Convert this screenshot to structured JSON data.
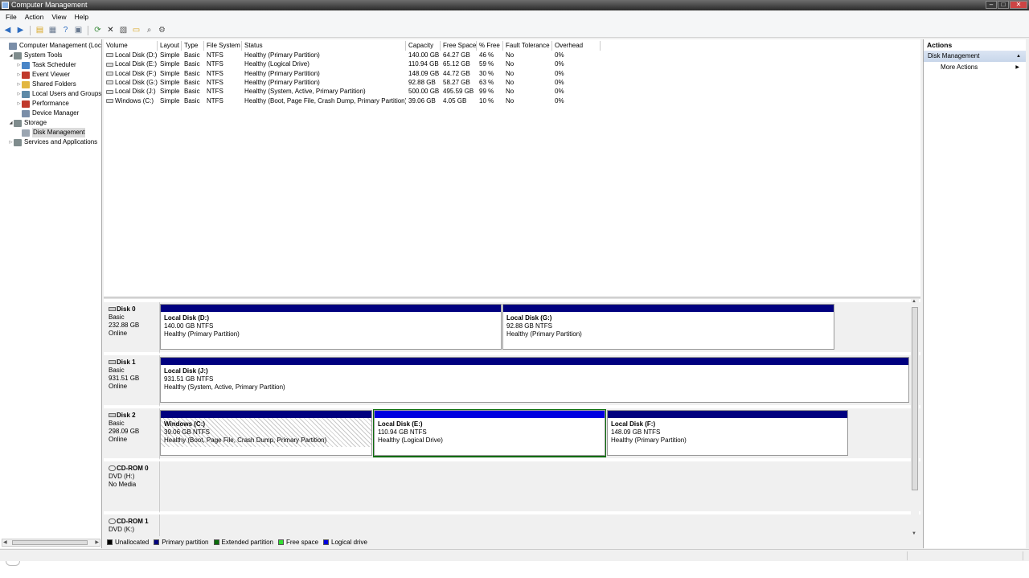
{
  "window": {
    "title": "Computer Management",
    "buttons": [
      "minimize",
      "maximize",
      "close"
    ]
  },
  "menu": [
    "File",
    "Action",
    "View",
    "Help"
  ],
  "toolbar": [
    "back-icon",
    "forward-icon",
    "up-folder-icon",
    "show-tree-icon",
    "help-icon",
    "show-hide-icon",
    "refresh-icon",
    "delete-icon",
    "properties-icon",
    "folder-open-icon",
    "search-icon",
    "settings-icon"
  ],
  "tree": [
    {
      "label": "Computer Management (Local",
      "level": 0,
      "expander": "",
      "icon": "computer-icon",
      "color": "#7a8ea8"
    },
    {
      "label": "System Tools",
      "level": 1,
      "expander": "◢",
      "icon": "tools-icon",
      "color": "#7f8c8d"
    },
    {
      "label": "Task Scheduler",
      "level": 2,
      "expander": "▷",
      "icon": "clock-icon",
      "color": "#4a86c8"
    },
    {
      "label": "Event Viewer",
      "level": 2,
      "expander": "▷",
      "icon": "event-viewer-icon",
      "color": "#c0392b"
    },
    {
      "label": "Shared Folders",
      "level": 2,
      "expander": "▷",
      "icon": "shared-folder-icon",
      "color": "#e2b740"
    },
    {
      "label": "Local Users and Groups",
      "level": 2,
      "expander": "▷",
      "icon": "users-icon",
      "color": "#5d8aa8"
    },
    {
      "label": "Performance",
      "level": 2,
      "expander": "▷",
      "icon": "performance-icon",
      "color": "#c0392b"
    },
    {
      "label": "Device Manager",
      "level": 2,
      "expander": "",
      "icon": "device-manager-icon",
      "color": "#7a8ea8"
    },
    {
      "label": "Storage",
      "level": 1,
      "expander": "◢",
      "icon": "storage-icon",
      "color": "#7f8c8d"
    },
    {
      "label": "Disk Management",
      "level": 2,
      "expander": "",
      "icon": "disk-management-icon",
      "color": "#9aa5b1",
      "selected": true
    },
    {
      "label": "Services and Applications",
      "level": 1,
      "expander": "▷",
      "icon": "services-icon",
      "color": "#7f8c8d"
    }
  ],
  "volume_table": {
    "columns": [
      "Volume",
      "Layout",
      "Type",
      "File System",
      "Status",
      "Capacity",
      "Free Space",
      "% Free",
      "Fault Tolerance",
      "Overhead"
    ],
    "rows": [
      [
        "Local Disk (D:)",
        "Simple",
        "Basic",
        "NTFS",
        "Healthy (Primary Partition)",
        "140.00 GB",
        "64.27 GB",
        "46 %",
        "No",
        "0%"
      ],
      [
        "Local Disk (E:)",
        "Simple",
        "Basic",
        "NTFS",
        "Healthy (Logical Drive)",
        "110.94 GB",
        "65.12 GB",
        "59 %",
        "No",
        "0%"
      ],
      [
        "Local Disk (F:)",
        "Simple",
        "Basic",
        "NTFS",
        "Healthy (Primary Partition)",
        "148.09 GB",
        "44.72 GB",
        "30 %",
        "No",
        "0%"
      ],
      [
        "Local Disk (G:)",
        "Simple",
        "Basic",
        "NTFS",
        "Healthy (Primary Partition)",
        "92.88 GB",
        "58.27 GB",
        "63 %",
        "No",
        "0%"
      ],
      [
        "Local Disk (J:)",
        "Simple",
        "Basic",
        "NTFS",
        "Healthy (System, Active, Primary Partition)",
        "500.00 GB",
        "495.59 GB",
        "99 %",
        "No",
        "0%"
      ],
      [
        "Windows (C:)",
        "Simple",
        "Basic",
        "NTFS",
        "Healthy (Boot, Page File, Crash Dump, Primary Partition)",
        "39.06 GB",
        "4.05 GB",
        "10 %",
        "No",
        "0%"
      ]
    ]
  },
  "disks": [
    {
      "name": "Disk 0",
      "type": "Basic",
      "size": "232.88 GB",
      "status": "Online",
      "partitions": [
        {
          "name": "Local Disk  (D:)",
          "size": "140.00 GB NTFS",
          "status": "Healthy (Primary Partition)"
        },
        {
          "name": "Local Disk  (G:)",
          "size": "92.88 GB NTFS",
          "status": "Healthy (Primary Partition)"
        }
      ]
    },
    {
      "name": "Disk 1",
      "type": "Basic",
      "size": "931.51 GB",
      "status": "Online",
      "partitions": [
        {
          "name": "Local Disk  (J:)",
          "size": "931.51 GB NTFS",
          "status": "Healthy (System, Active, Primary Partition)"
        }
      ]
    },
    {
      "name": "Disk 2",
      "type": "Basic",
      "size": "298.09 GB",
      "status": "Online",
      "partitions": [
        {
          "name": "Windows  (C:)",
          "size": "39.06 GB NTFS",
          "status": "Healthy (Boot, Page File, Crash Dump, Primary Partition)"
        },
        {
          "name": "Local Disk  (E:)",
          "size": "110.94 GB NTFS",
          "status": "Healthy (Logical Drive)"
        },
        {
          "name": "Local Disk  (F:)",
          "size": "148.09 GB NTFS",
          "status": "Healthy (Primary Partition)"
        }
      ]
    },
    {
      "name": "CD-ROM 0",
      "type": "DVD (H:)",
      "size": "",
      "status": "No Media",
      "partitions": []
    },
    {
      "name": "CD-ROM 1",
      "type": "DVD (K:)",
      "size": "",
      "status": "",
      "partitions": []
    }
  ],
  "legend": [
    {
      "label": "Unallocated",
      "color": "#000000"
    },
    {
      "label": "Primary partition",
      "color": "#00007f"
    },
    {
      "label": "Extended partition",
      "color": "#0b6d0b"
    },
    {
      "label": "Free space",
      "color": "#33e033"
    },
    {
      "label": "Logical drive",
      "color": "#0000e0"
    }
  ],
  "actions": {
    "title": "Actions",
    "section": "Disk Management",
    "items": [
      "More Actions"
    ]
  }
}
